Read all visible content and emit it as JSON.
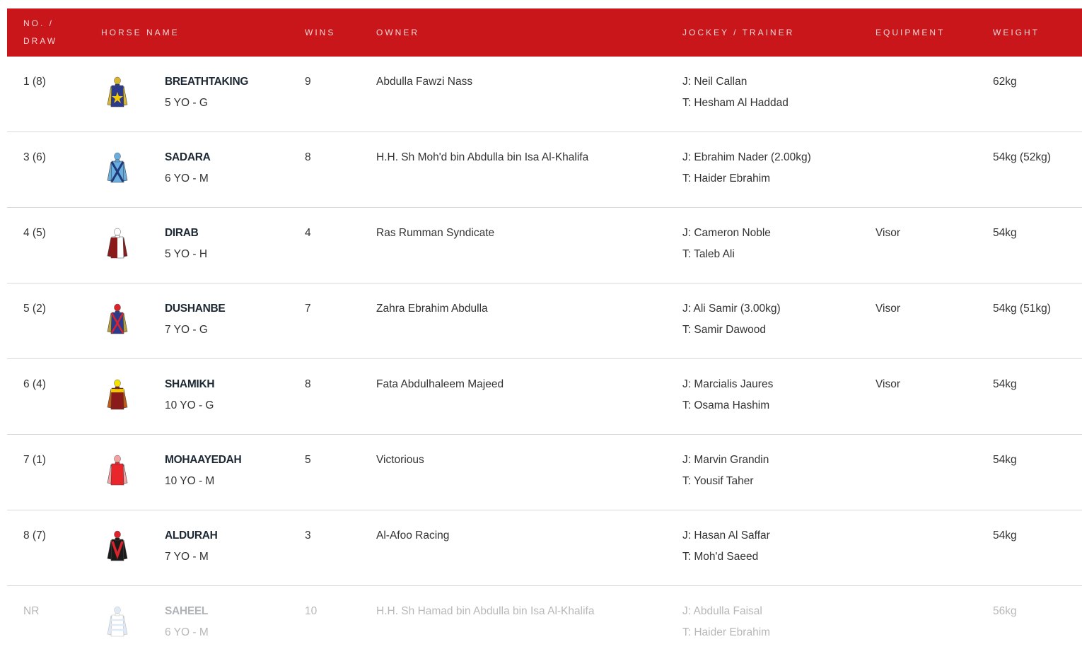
{
  "header": {
    "no_draw_line1": "NO. /",
    "no_draw_line2": "DRAW",
    "horse_name": "HORSE NAME",
    "wins": "WINS",
    "owner": "OWNER",
    "jockey_trainer": "JOCKEY / TRAINER",
    "equipment": "EQUIPMENT",
    "weight": "WEIGHT"
  },
  "colors": {
    "header_bg": "#c8161b",
    "header_text": "#f4d6d6",
    "horse_name": "#1c2833"
  },
  "rows": [
    {
      "no": "1 (8)",
      "name": "BREATHTAKING",
      "age": "5 YO - G",
      "wins": "9",
      "owner": "Abdulla Fawzi Nass",
      "jockey": "J: Neil Callan",
      "trainer": "T: Hesham Al Haddad",
      "equipment": "",
      "weight": "62kg",
      "silk": {
        "body": "#2b3a8c",
        "sleeve": "#d9b630",
        "cap": "#d9b630",
        "emblem": "star",
        "emblem_color": "#f2c800"
      }
    },
    {
      "no": "3 (6)",
      "name": "SADARA",
      "age": "6 YO - M",
      "wins": "8",
      "owner": "H.H. Sh Moh'd bin Abdulla bin Isa Al-Khalifa",
      "jockey": "J: Ebrahim Nader (2.00kg)",
      "trainer": "T: Haider Ebrahim",
      "equipment": "",
      "weight": "54kg (52kg)",
      "silk": {
        "body": "#6aaee0",
        "sleeve": "#6aaee0",
        "cap": "#6aaee0",
        "emblem": "cross-belts",
        "emblem_color": "#1f3a7a"
      }
    },
    {
      "no": "4 (5)",
      "name": "DIRAB",
      "age": "5 YO - H",
      "wins": "4",
      "owner": "Ras Rumman Syndicate",
      "jockey": "J: Cameron Noble",
      "trainer": "T: Taleb Ali",
      "equipment": "Visor",
      "weight": "54kg",
      "silk": {
        "body": "#ffffff",
        "sleeve": "#8b1a1a",
        "cap": "#ffffff",
        "emblem": "halves",
        "emblem_color": "#8b1a1a"
      }
    },
    {
      "no": "5 (2)",
      "name": "DUSHANBE",
      "age": "7 YO - G",
      "wins": "7",
      "owner": "Zahra Ebrahim Abdulla",
      "jockey": "J: Ali Samir (3.00kg)",
      "trainer": "T: Samir Dawood",
      "equipment": "Visor",
      "weight": "54kg (51kg)",
      "silk": {
        "body": "#2b3a8c",
        "sleeve": "#b8a03a",
        "cap": "#d9242b",
        "emblem": "cross",
        "emblem_color": "#d9242b"
      }
    },
    {
      "no": "6 (4)",
      "name": "SHAMIKH",
      "age": "10 YO - G",
      "wins": "8",
      "owner": "Fata Abdulhaleem Majeed",
      "jockey": "J: Marcialis Jaures",
      "trainer": "T: Osama Hashim",
      "equipment": "Visor",
      "weight": "54kg",
      "silk": {
        "body": "#8b1a1a",
        "sleeve": "#c45a10",
        "cap": "#f2e200",
        "emblem": "yoke",
        "emblem_color": "#f2c800"
      }
    },
    {
      "no": "7 (1)",
      "name": "MOHAAYEDAH",
      "age": "10 YO - M",
      "wins": "5",
      "owner": "Victorious",
      "jockey": "J: Marvin Grandin",
      "trainer": "T: Yousif Taher",
      "equipment": "",
      "weight": "54kg",
      "silk": {
        "body": "#e8262c",
        "sleeve": "#f3a0a0",
        "cap": "#f3a0a0",
        "emblem": "none",
        "emblem_color": "#e8262c"
      }
    },
    {
      "no": "8 (7)",
      "name": "ALDURAH",
      "age": "7 YO - M",
      "wins": "3",
      "owner": "Al-Afoo Racing",
      "jockey": "J: Hasan Al Saffar",
      "trainer": "T: Moh'd Saeed",
      "equipment": "",
      "weight": "54kg",
      "silk": {
        "body": "#1a1a1a",
        "sleeve": "#1a1a1a",
        "cap": "#d9242b",
        "emblem": "chevron",
        "emblem_color": "#d9242b"
      }
    },
    {
      "no": "NR",
      "name": "SAHEEL",
      "age": "6 YO - M",
      "wins": "10",
      "owner": "H.H. Sh Hamad bin Abdulla bin Isa Al-Khalifa",
      "jockey": "J: Abdulla Faisal",
      "trainer": "T: Haider Ebrahim",
      "equipment": "",
      "weight": "56kg",
      "silk": {
        "body": "#ffffff",
        "sleeve": "#a9c6ea",
        "cap": "#a9c6ea",
        "emblem": "diamonds",
        "emblem_color": "#a9c6ea"
      }
    }
  ]
}
